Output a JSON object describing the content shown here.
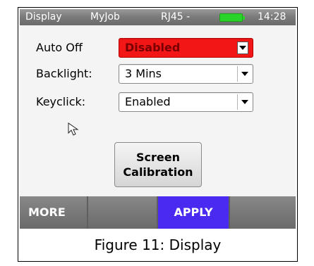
{
  "status_bar": {
    "title": "Display",
    "job": "MyJob",
    "port": "RJ45 -",
    "battery_icon": "battery-icon",
    "time": "14:28"
  },
  "settings": {
    "auto_off": {
      "label": "Auto Off",
      "value": "Disabled",
      "highlight_color": "#f21616"
    },
    "backlight": {
      "label": "Backlight:",
      "value": "3 Mins"
    },
    "keyclick": {
      "label": "Keyclick:",
      "value": "Enabled"
    }
  },
  "calibration_button": {
    "line1": "Screen",
    "line2": "Calibration"
  },
  "softkeys": [
    "MORE",
    "",
    "APPLY",
    ""
  ],
  "softkey_active_color": "#4a29f0",
  "caption": "Figure 11: Display"
}
